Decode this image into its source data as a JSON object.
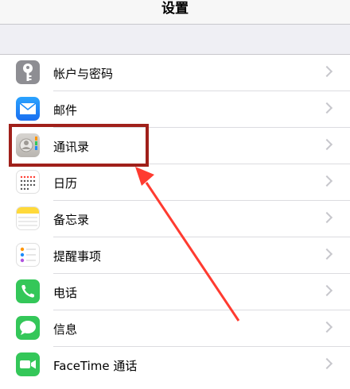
{
  "header": {
    "title": "设置"
  },
  "items": [
    {
      "label": "帐户与密码",
      "icon": "key-icon",
      "color": "#8e8e93"
    },
    {
      "label": "邮件",
      "icon": "mail-icon",
      "color": "#1d8cf8"
    },
    {
      "label": "通讯录",
      "icon": "contacts-icon",
      "color": "#c9c6c2"
    },
    {
      "label": "日历",
      "icon": "calendar-icon",
      "color": "#ffffff"
    },
    {
      "label": "备忘录",
      "icon": "notes-icon",
      "color": "#ffd93a"
    },
    {
      "label": "提醒事项",
      "icon": "reminders-icon",
      "color": "#ffffff"
    },
    {
      "label": "电话",
      "icon": "phone-icon",
      "color": "#34c759"
    },
    {
      "label": "信息",
      "icon": "messages-icon",
      "color": "#34c759"
    },
    {
      "label": "FaceTime 通话",
      "icon": "facetime-icon",
      "color": "#34c759"
    }
  ],
  "annotation": {
    "highlight_color": "#a0201a",
    "arrow_color": "#ff3b30"
  }
}
